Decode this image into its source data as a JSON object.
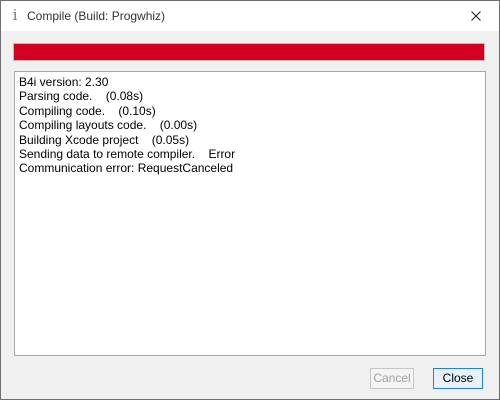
{
  "window": {
    "title": "Compile (Build: Progwhiz)",
    "app_icon_glyph": "i",
    "app_icon_name": "info-icon",
    "close_icon_name": "close-icon"
  },
  "progress": {
    "percent": 100,
    "color": "#d40024",
    "status": "error"
  },
  "log": {
    "lines": [
      "B4i version: 2.30",
      "Parsing code.    (0.08s)",
      "Compiling code.    (0.10s)",
      "Compiling layouts code.    (0.00s)",
      "Building Xcode project    (0.05s)",
      "Sending data to remote compiler.    Error",
      "Communication error: RequestCanceled"
    ]
  },
  "buttons": {
    "cancel_label": "Cancel",
    "cancel_enabled": false,
    "close_label": "Close",
    "close_default": true
  },
  "colors": {
    "accent": "#2a7fd4",
    "error": "#d40024",
    "window_background": "#f0f0f0"
  }
}
